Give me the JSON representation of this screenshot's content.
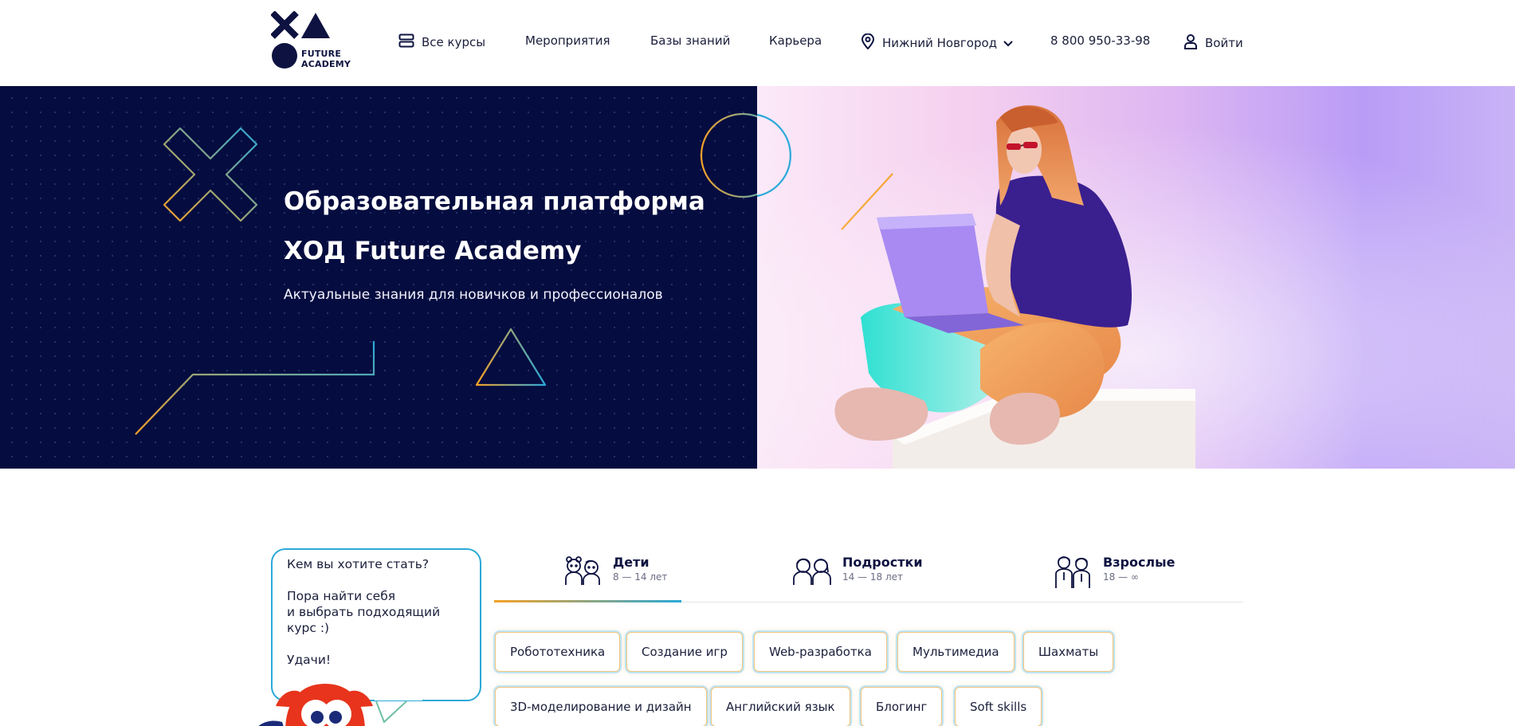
{
  "header": {
    "logo": {
      "brand_line1": "FUTURE",
      "brand_line2": "ACADEMY"
    },
    "nav": {
      "all_courses": "Все курсы",
      "events": "Мероприятия",
      "knowledge": "Базы знаний",
      "career": "Карьера",
      "city": "Нижний Новгород",
      "phone": "8 800 950-33-98",
      "login": "Войти"
    }
  },
  "hero": {
    "title_line1": "Образовательная платформа",
    "title_line2": "ХОД Future Academy",
    "subtitle": "Актуальные знания для новичков и профессионалов"
  },
  "bubble": {
    "question": "Кем вы хотите стать?",
    "line2": "Пора найти себя",
    "line3": "и выбрать подходящий",
    "line4": "курс :)",
    "line5": "Удачи!"
  },
  "tabs": [
    {
      "name": "Дети",
      "age": "8 — 14 лет",
      "icon": "kids-icon"
    },
    {
      "name": "Подростки",
      "age": "14 — 18 лет",
      "icon": "teens-icon"
    },
    {
      "name": "Взрослые",
      "age": "18 — ∞",
      "icon": "adults-icon"
    }
  ],
  "chips_row1": [
    "Робототехника",
    "Создание игр",
    "Web-разработка",
    "Мультимедиа",
    "Шахматы"
  ],
  "chips_row2": [
    "3D-моделирование и дизайн",
    "Английский язык",
    "Блогинг",
    "Soft skills"
  ],
  "colors": {
    "navy": "#0d1240",
    "hero_bg": "#050c3f",
    "accent_orange": "#f5a227",
    "accent_blue": "#2aa9d8",
    "mascot_red": "#e8341c"
  }
}
